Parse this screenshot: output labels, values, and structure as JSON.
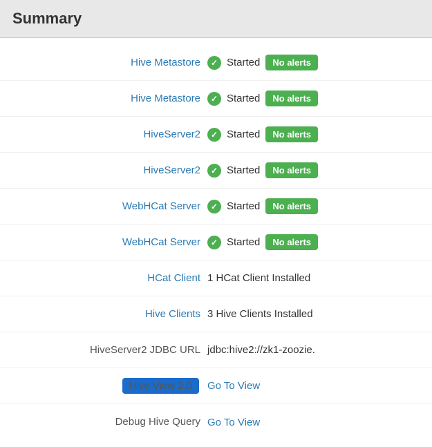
{
  "header": {
    "title": "Summary"
  },
  "rows": [
    {
      "id": "hive-metastore-1",
      "label": "Hive Metastore",
      "label_type": "link",
      "status_icon": true,
      "status_text": "Started",
      "badge": "No alerts",
      "badge_color": "#4caf50"
    },
    {
      "id": "hive-metastore-2",
      "label": "Hive Metastore",
      "label_type": "link",
      "status_icon": true,
      "status_text": "Started",
      "badge": "No alerts",
      "badge_color": "#4caf50"
    },
    {
      "id": "hiveserver2-1",
      "label": "HiveServer2",
      "label_type": "link",
      "status_icon": true,
      "status_text": "Started",
      "badge": "No alerts",
      "badge_color": "#4caf50"
    },
    {
      "id": "hiveserver2-2",
      "label": "HiveServer2",
      "label_type": "link",
      "status_icon": true,
      "status_text": "Started",
      "badge": "No alerts",
      "badge_color": "#4caf50"
    },
    {
      "id": "webhcat-server-1",
      "label": "WebHCat Server",
      "label_type": "link",
      "status_icon": true,
      "status_text": "Started",
      "badge": "No alerts",
      "badge_color": "#4caf50"
    },
    {
      "id": "webhcat-server-2",
      "label": "WebHCat Server",
      "label_type": "link",
      "status_icon": true,
      "status_text": "Started",
      "badge": "No alerts",
      "badge_color": "#4caf50"
    },
    {
      "id": "hcat-client",
      "label": "HCat Client",
      "label_type": "link",
      "status_icon": false,
      "status_text": "1 HCat Client Installed",
      "badge": null
    },
    {
      "id": "hive-clients",
      "label": "Hive Clients",
      "label_type": "link",
      "status_icon": false,
      "status_text": "3 Hive Clients Installed",
      "badge": null
    },
    {
      "id": "hiveserver2-jdbc",
      "label": "HiveServer2 JDBC URL",
      "label_type": "plain",
      "status_icon": false,
      "status_text": "jdbc:hive2://zk1-zoozie.",
      "badge": null
    },
    {
      "id": "hive-view-2",
      "label": "Hive View 2.0",
      "label_type": "highlight",
      "status_icon": false,
      "status_text": null,
      "badge": null,
      "action_link": "Go To View"
    },
    {
      "id": "debug-hive-query",
      "label": "Debug Hive Query",
      "label_type": "plain",
      "status_icon": false,
      "status_text": null,
      "badge": null,
      "action_link": "Go To View"
    }
  ]
}
